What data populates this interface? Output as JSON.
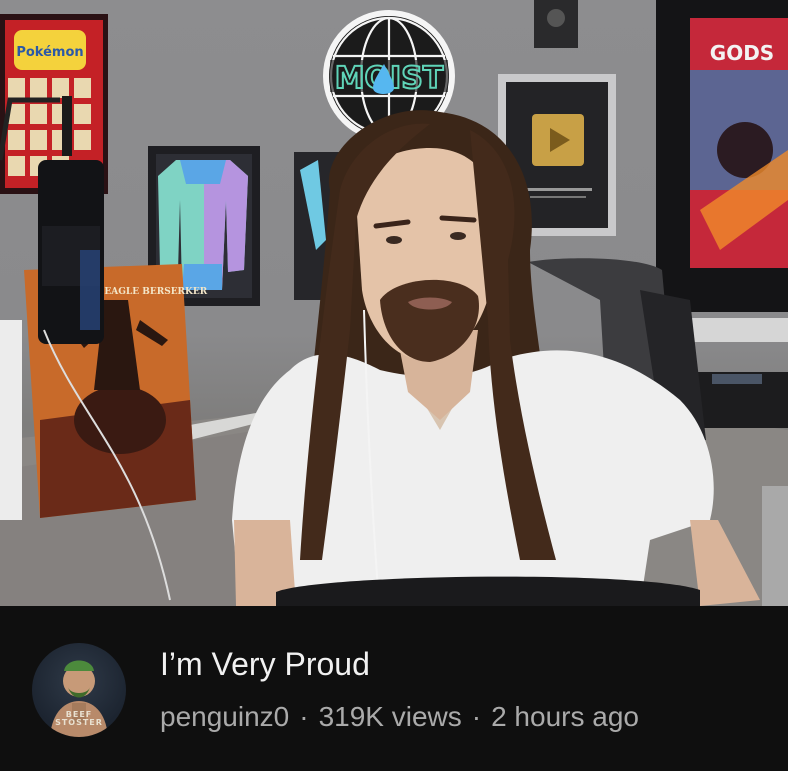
{
  "video": {
    "title": "I’m Very Proud",
    "channel": "penguinz0",
    "views": "319K views",
    "age": "2 hours ago",
    "separator": "·"
  },
  "thumbnail": {
    "sign_text": "MOIST",
    "poster_text": "BEAGLE BERSERKER",
    "frame_text": "GODS",
    "pokemon_text": "Pokémon"
  },
  "avatar": {
    "text_line1": "BEEF",
    "text_line2": "STOSTER"
  },
  "colors": {
    "background": "#0f0f0f",
    "title": "#f1f1f1",
    "meta": "#aaaaaa",
    "wall": "#8c8c8e",
    "sign_accent": "#5fd4b8"
  }
}
